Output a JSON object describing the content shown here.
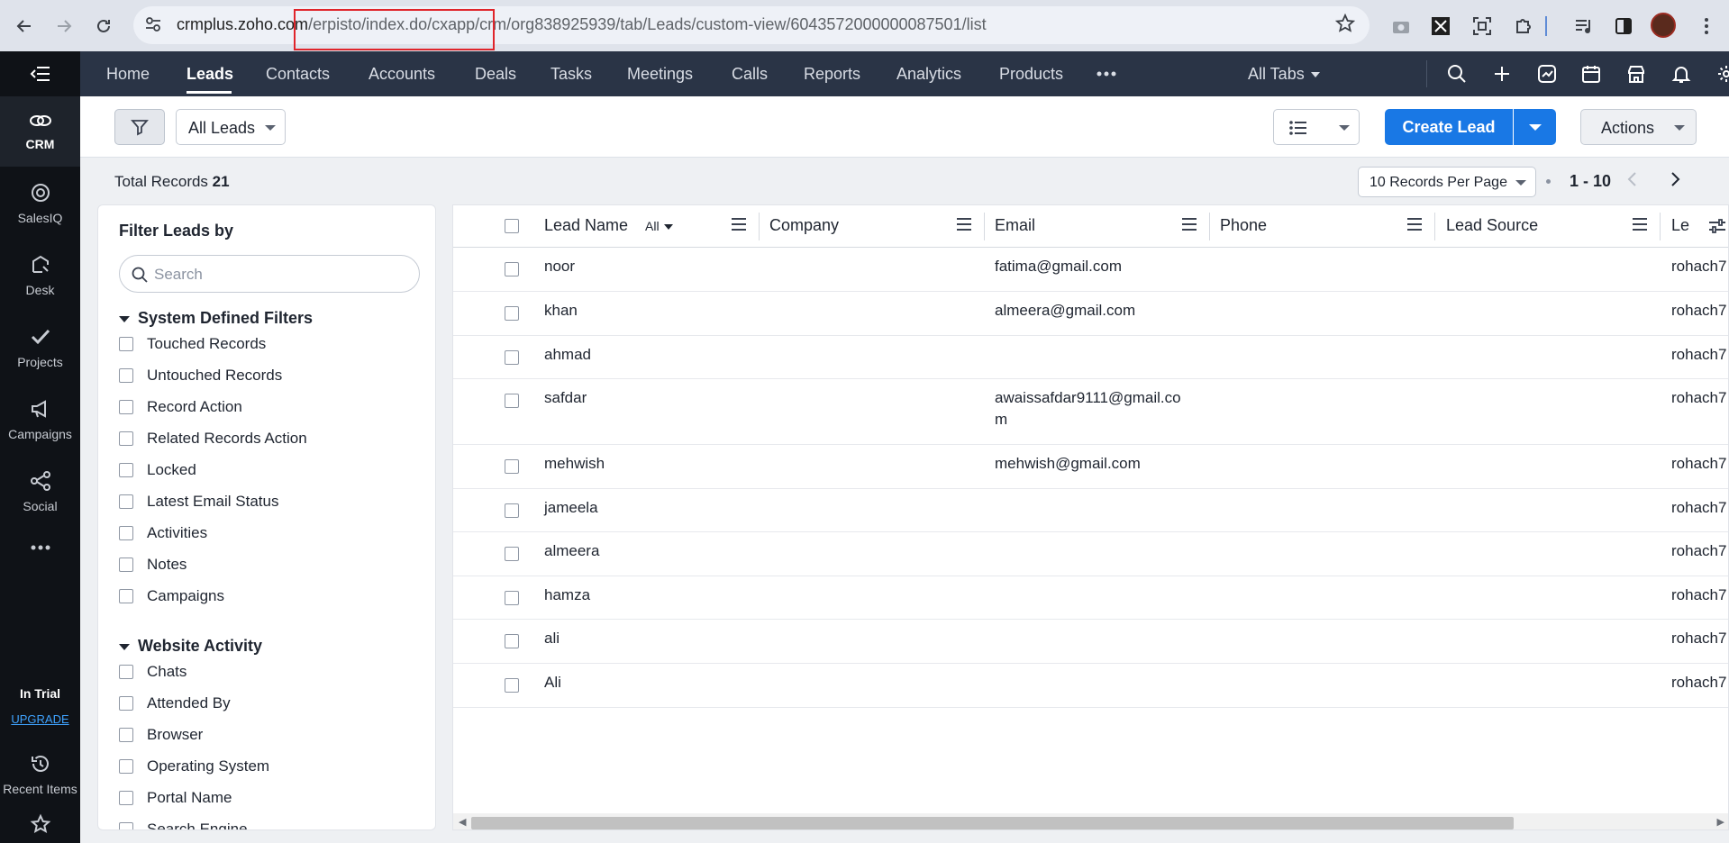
{
  "browser": {
    "url_host": "crmplus.zoho.com",
    "url_path_hl": "/erpisto",
    "url_rest": "/index.do/cxapp/crm/org838925939/tab/Leads/custom-view/6043572000000087501/list"
  },
  "rail": {
    "items": [
      {
        "label": "CRM",
        "icon": "crm-icon"
      },
      {
        "label": "SalesIQ",
        "icon": "salesiq-icon"
      },
      {
        "label": "Desk",
        "icon": "desk-icon"
      },
      {
        "label": "Projects",
        "icon": "projects-icon"
      },
      {
        "label": "Campaigns",
        "icon": "campaigns-icon"
      },
      {
        "label": "Social",
        "icon": "social-icon"
      }
    ],
    "trial_label": "In Trial",
    "upgrade_label": "UPGRADE",
    "recent_label": "Recent Items"
  },
  "nav": {
    "tabs": [
      "Home",
      "Leads",
      "Contacts",
      "Accounts",
      "Deals",
      "Tasks",
      "Meetings",
      "Calls",
      "Reports",
      "Analytics",
      "Products"
    ],
    "active_tab": "Leads",
    "all_tabs_label": "All Tabs"
  },
  "toolbar": {
    "view_label": "All Leads",
    "create_label": "Create Lead",
    "actions_label": "Actions"
  },
  "records": {
    "total_label": "Total Records",
    "total_count": "21",
    "per_page_label": "10 Records Per Page",
    "range_label": "1 - 10"
  },
  "filters": {
    "title": "Filter Leads by",
    "search_placeholder": "Search",
    "system_title": "System Defined Filters",
    "system_items": [
      "Touched Records",
      "Untouched Records",
      "Record Action",
      "Related Records Action",
      "Locked",
      "Latest Email Status",
      "Activities",
      "Notes",
      "Campaigns"
    ],
    "website_title": "Website Activity",
    "website_items": [
      "Chats",
      "Attended By",
      "Browser",
      "Operating System",
      "Portal Name",
      "Search Engine"
    ]
  },
  "table": {
    "columns": {
      "lead_name": "Lead Name",
      "all_filter": "All",
      "company": "Company",
      "email": "Email",
      "phone": "Phone",
      "lead_source": "Lead Source",
      "owner": "Le"
    },
    "rows": [
      {
        "name": "noor",
        "email": "fatima@gmail.com",
        "owner": "rohach7"
      },
      {
        "name": "khan",
        "email": "almeera@gmail.com",
        "owner": "rohach7"
      },
      {
        "name": "ahmad",
        "email": "",
        "owner": "rohach7"
      },
      {
        "name": "safdar",
        "email": "awaissafdar9111@gmail.com",
        "owner": "rohach7"
      },
      {
        "name": "mehwish",
        "email": "mehwish@gmail.com",
        "owner": "rohach7"
      },
      {
        "name": "jameela",
        "email": "",
        "owner": "rohach7"
      },
      {
        "name": "almeera",
        "email": "",
        "owner": "rohach7"
      },
      {
        "name": "hamza",
        "email": "",
        "owner": "rohach7"
      },
      {
        "name": "ali",
        "email": "",
        "owner": "rohach7"
      },
      {
        "name": "Ali",
        "email": "",
        "owner": "rohach7"
      }
    ]
  },
  "colors": {
    "accent": "#1978e5",
    "nav_bg": "#2a3446",
    "rail_bg": "#0f1217",
    "highlight_box": "#e0252b"
  }
}
